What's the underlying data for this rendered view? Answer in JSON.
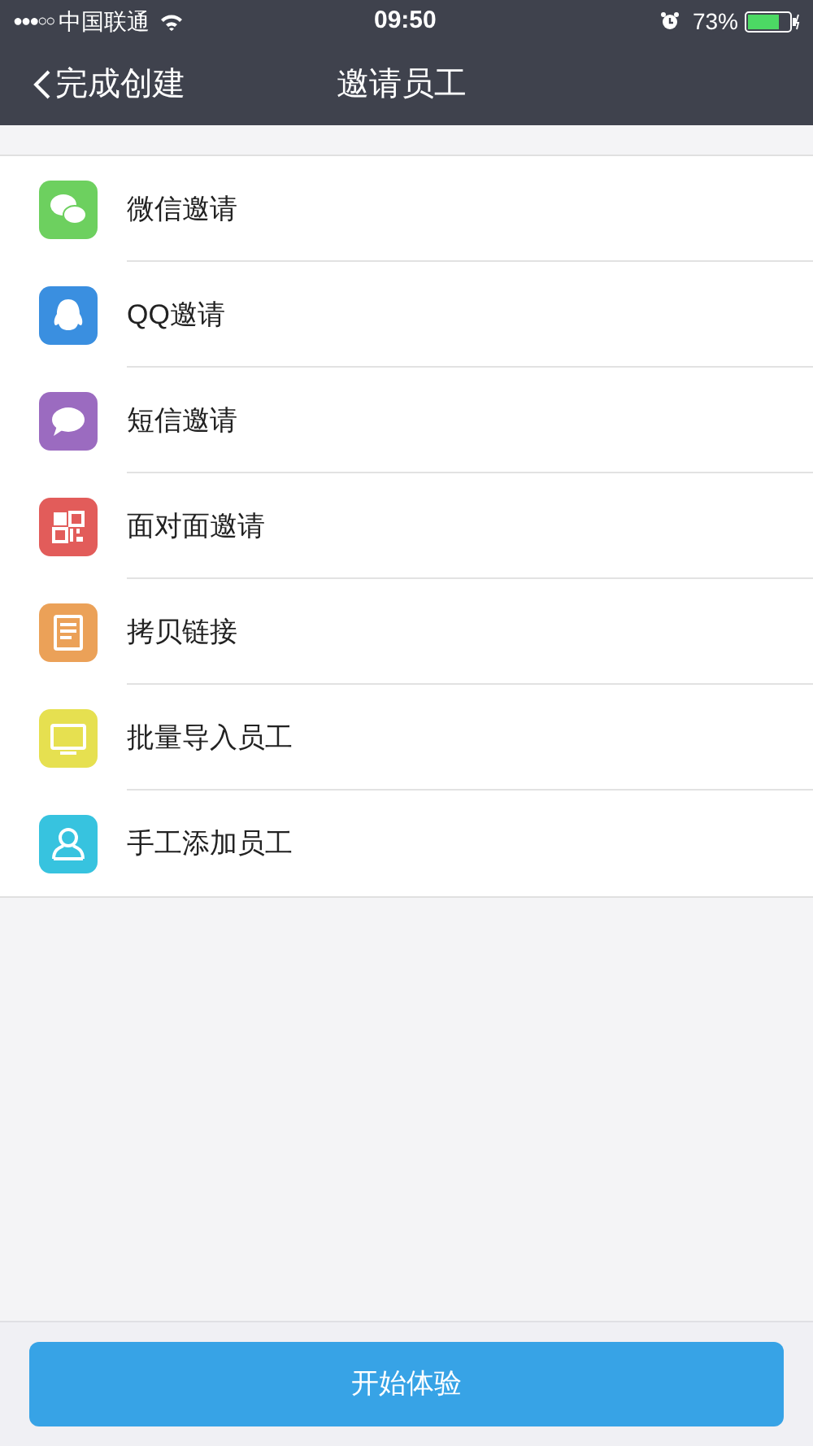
{
  "status_bar": {
    "signal": "●●●○○",
    "carrier": "中国联通",
    "time": "09:50",
    "battery": "73%"
  },
  "nav": {
    "back": "完成创建",
    "title": "邀请员工"
  },
  "items": [
    {
      "kind": "wechat",
      "label": "微信邀请",
      "color": "#6dd05f"
    },
    {
      "kind": "qq",
      "label": "QQ邀请",
      "color": "#3a8fe0"
    },
    {
      "kind": "sms",
      "label": "短信邀请",
      "color": "#9b6bc0"
    },
    {
      "kind": "qr",
      "label": "面对面邀请",
      "color": "#e25c5a"
    },
    {
      "kind": "doc",
      "label": "拷贝链接",
      "color": "#eba158"
    },
    {
      "kind": "monitor",
      "label": "批量导入员工",
      "color": "#e6e050"
    },
    {
      "kind": "person",
      "label": "手工添加员工",
      "color": "#37c3df"
    }
  ],
  "start_button": "开始体验"
}
